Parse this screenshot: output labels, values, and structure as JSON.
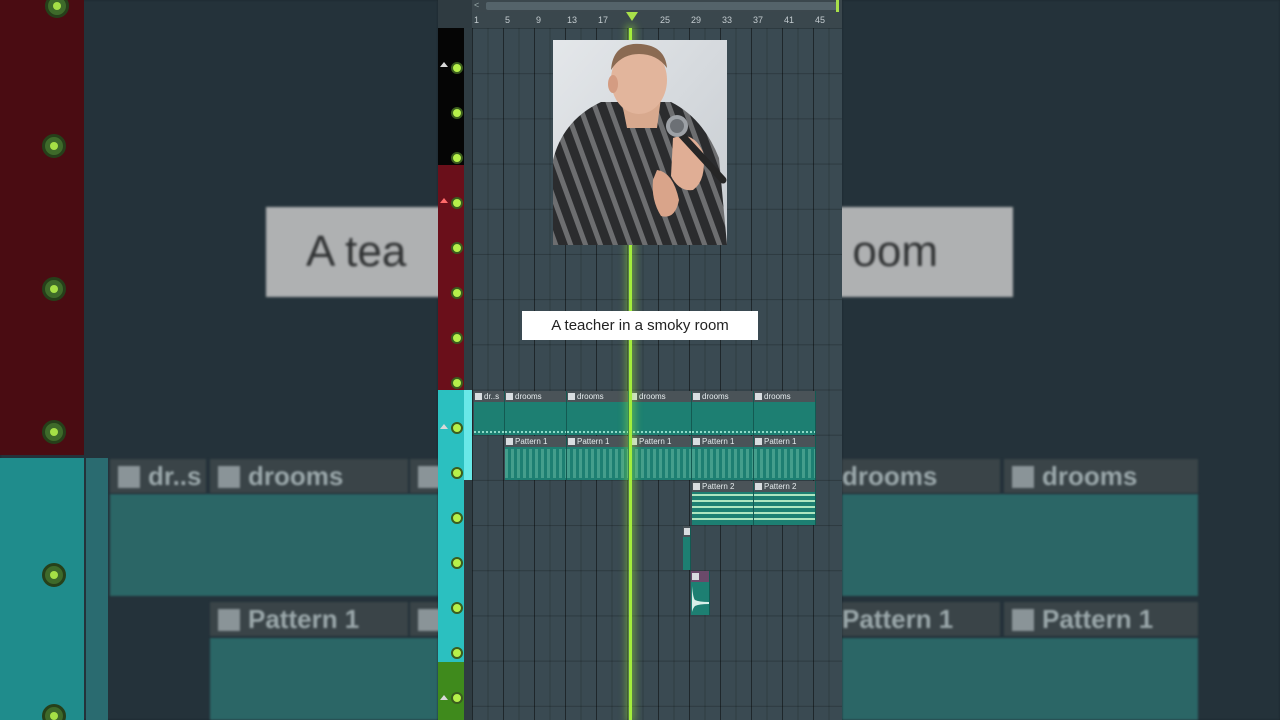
{
  "background_caption": {
    "left_text": "A tea",
    "right_text": "oom"
  },
  "background_clips": {
    "drums_short": "dr..s",
    "drums": "drooms",
    "pattern": "Pattern 1"
  },
  "ruler": {
    "bars": [
      "1",
      "5",
      "9",
      "13",
      "17",
      "21",
      "25",
      "29",
      "33",
      "37",
      "41",
      "45"
    ]
  },
  "playlist": {
    "drum_clips": [
      "dr..s",
      "drooms",
      "drooms",
      "drooms",
      "drooms",
      "drooms"
    ],
    "pattern1_clips": [
      "Pattern 1",
      "Pattern 1",
      "Pattern 1",
      "Pattern 1",
      "Pattern 1"
    ],
    "pattern2_clips": [
      "Pattern 2",
      "Pattern 2"
    ]
  },
  "caption": {
    "text": "A teacher in a smoky room"
  },
  "colors": {
    "accent": "#a4ee3c",
    "clip": "#1d7f72",
    "track_red": "#6a0f1a",
    "track_black": "#050505",
    "track_teal": "#2bc0c0",
    "track_green": "#3f8a1c"
  }
}
